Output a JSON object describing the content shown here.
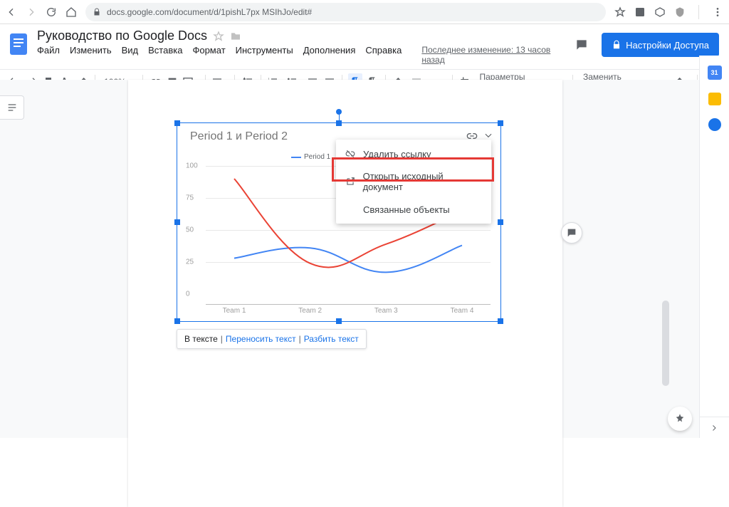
{
  "browser": {
    "url": "docs.google.com/document/d/1pishL7px                                           MSIhJo/edit#"
  },
  "doc": {
    "title": "Руководство по Google Docs",
    "menus": [
      "Файл",
      "Изменить",
      "Вид",
      "Вставка",
      "Формат",
      "Инструменты",
      "Дополнения",
      "Справка"
    ],
    "last_edit": "Последнее изменение: 13 часов назад",
    "share_label": "Настройки Доступа"
  },
  "toolbar": {
    "zoom": "100%",
    "img_params": "Параметры изображений",
    "replace_img": "Заменить изображение"
  },
  "context_menu": {
    "items": [
      "Удалить ссылку",
      "Открыть исходный документ",
      "Связанные объекты"
    ]
  },
  "options_bar": {
    "active": "В тексте",
    "wrap": "Переносить текст",
    "break": "Разбить текст"
  },
  "chart_data": {
    "type": "line",
    "title": "Period 1 и Period 2",
    "categories": [
      "Team 1",
      "Team 2",
      "Team 3",
      "Team 4"
    ],
    "series": [
      {
        "name": "Period 1",
        "color": "#4285f4",
        "values": [
          28,
          36,
          17,
          38
        ]
      },
      {
        "name": "Period 2",
        "color": "#ea4335",
        "values": [
          90,
          24,
          39,
          65
        ]
      }
    ],
    "legend_visible": "Period 1",
    "ylim": [
      0,
      100
    ],
    "yticks": [
      0,
      25,
      50,
      75,
      100
    ]
  },
  "sidebar": {
    "cal": "31"
  }
}
